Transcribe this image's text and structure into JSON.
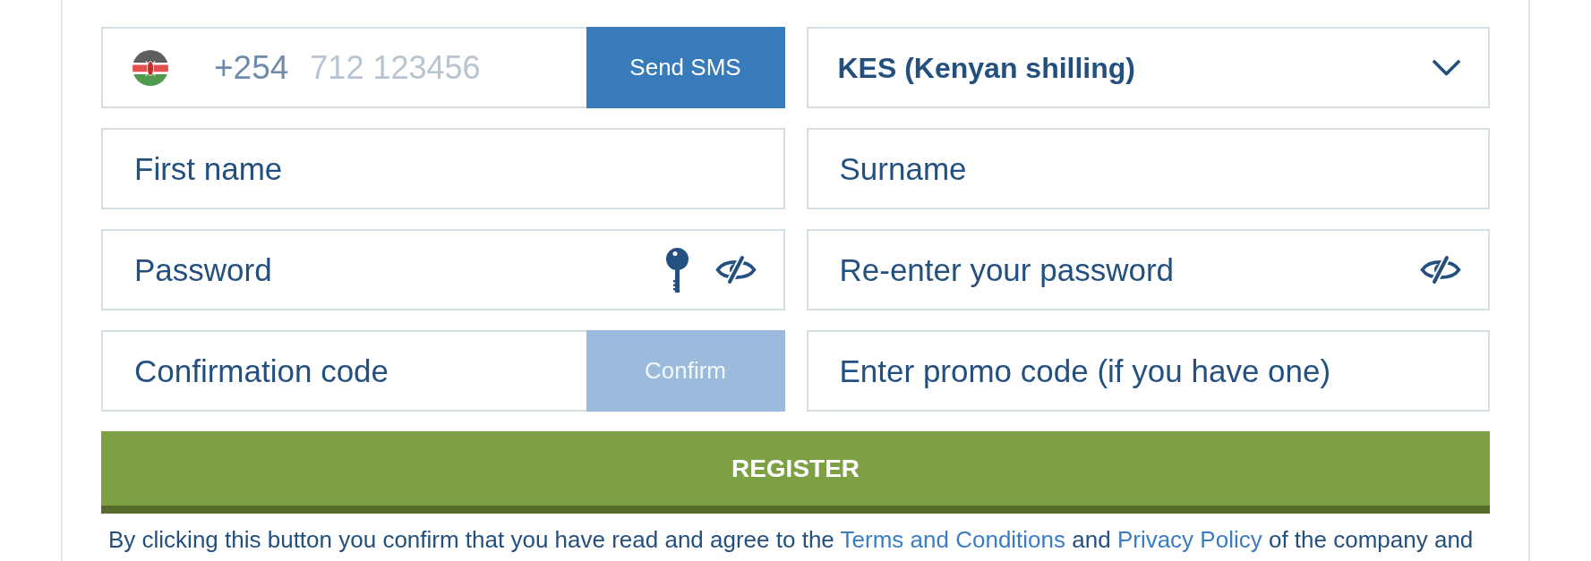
{
  "fields": [
    {
      "kind": "phone",
      "country_code": "+254",
      "placeholder": "712 123456",
      "button": {
        "label": "Send SMS",
        "disabled": false
      }
    },
    {
      "kind": "select",
      "value": "KES (Kenyan shilling)"
    },
    {
      "kind": "text",
      "placeholder": "First name"
    },
    {
      "kind": "text",
      "placeholder": "Surname"
    },
    {
      "kind": "password",
      "placeholder": "Password"
    },
    {
      "kind": "repeat",
      "placeholder": "Re-enter your password"
    },
    {
      "kind": "code",
      "placeholder": "Confirmation code",
      "button": {
        "label": "Confirm",
        "disabled": true
      }
    },
    {
      "kind": "text",
      "placeholder": "Enter promo code (if you have one)"
    }
  ],
  "register_button": {
    "label": "REGISTER"
  },
  "agreement": [
    {
      "kind": "text",
      "text": "By clicking this button you confirm that you have read and agree to the "
    },
    {
      "kind": "link",
      "text": "Terms and Conditions"
    },
    {
      "kind": "text",
      "text": " and "
    },
    {
      "kind": "link",
      "text": "Privacy Policy"
    },
    {
      "kind": "text",
      "text": " of the company and"
    }
  ]
}
